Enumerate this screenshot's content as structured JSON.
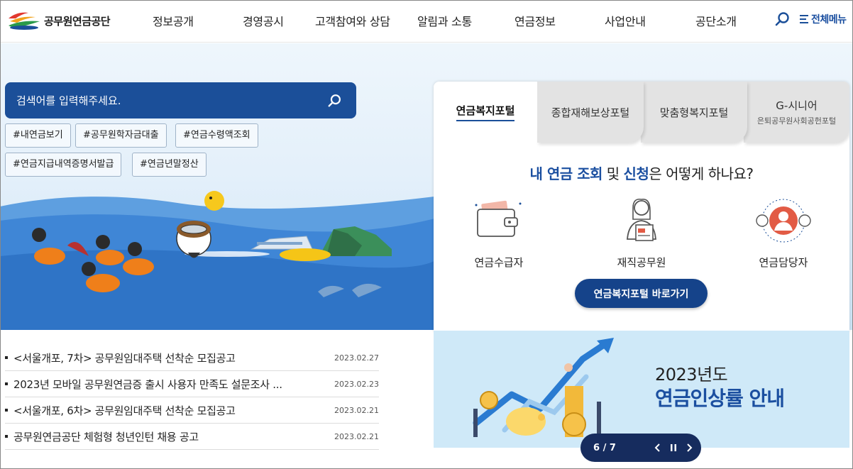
{
  "header": {
    "logo_text": "공무원연금공단",
    "nav": [
      "정보공개",
      "경영공시",
      "고객참여와 상담",
      "알림과 소통",
      "연금정보",
      "사업안내",
      "공단소개"
    ],
    "all_menu_label": "전체메뉴"
  },
  "search": {
    "placeholder": "검색어를 입력해주세요.",
    "tags": [
      "#내연금보기",
      "#공무원학자금대출",
      "#연금수령액조회",
      "#연금지급내역증명서발급",
      "#연금년말정산"
    ]
  },
  "portal": {
    "tabs": [
      {
        "label": "연금복지포털",
        "sub": ""
      },
      {
        "label": "종합재해보상포털",
        "sub": ""
      },
      {
        "label": "맞춤형복지포털",
        "sub": ""
      },
      {
        "label": "G-시니어",
        "sub": "은퇴공무원사회공헌포털"
      }
    ],
    "question": {
      "part1": "내 연금 조회",
      "part2": " 및 ",
      "part3": "신청",
      "part4": "은 어떻게 하나요?"
    },
    "personas": [
      "연금수급자",
      "재직공무원",
      "연금담당자"
    ],
    "button_label": "연금복지포털 바로가기"
  },
  "notices": [
    {
      "title": "<서울개포, 7차> 공무원임대주택 선착순 모집공고",
      "date": "2023.02.27"
    },
    {
      "title": "2023년 모바일 공무원연금증 출시 사용자 만족도 설문조사 ...",
      "date": "2023.02.23"
    },
    {
      "title": "<서울개포, 6차> 공무원임대주택 선착순 모집공고",
      "date": "2023.02.21"
    },
    {
      "title": "공무원연금공단 체험형 청년인턴 채용 공고",
      "date": "2023.02.21"
    }
  ],
  "banner": {
    "year": "2023년도",
    "title": "연금인상률 안내"
  },
  "pager": {
    "counter": "6 / 7"
  },
  "colors": {
    "brand_navy": "#1b4f99",
    "pager_bg": "#162c5e",
    "banner_bg": "#cfe9f8"
  }
}
